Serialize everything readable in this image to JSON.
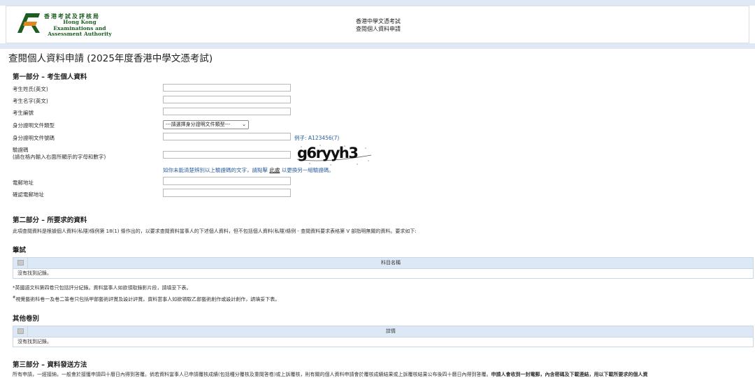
{
  "header": {
    "logo_cn": "香港考試及評核局",
    "logo_en_1": "Hong Kong",
    "logo_en_2": "Examinations and",
    "logo_en_3": "Assessment Authority",
    "title_1": "香港中學文憑考試",
    "title_2": "查閱個人資料申請"
  },
  "page_title": "查閱個人資料申請 (2025年度香港中學文憑考試)",
  "part1": {
    "heading": "第一部分 – 考生個人資料",
    "surname_label": "考生姓氏(英文)",
    "given_name_label": "考生名字(英文)",
    "candidate_no_label": "考生編號",
    "id_type_label": "身分證明文件類型",
    "id_type_selected": "---請選擇身分證明文件類型---",
    "id_no_label": "身分證明文件號碼",
    "id_no_example": "例子: A123456(7)",
    "captcha_label_1": "驗證碼",
    "captcha_label_2": "(請在格內輸入右面所顯示的字母和數字)",
    "captcha_text": "g6ryyh3",
    "captcha_hint_pre": "如你未能清楚辨別以上驗證碼的文字，請點擊",
    "captcha_hint_link": "此處",
    "captcha_hint_post": "以更換另一組驗證碼。",
    "email_label": "電郵地址",
    "confirm_email_label": "確認電郵地址"
  },
  "part2": {
    "heading": "第二部分 – 所要求的資料",
    "desc": "此項查閱資料是根據個人資料(私隱)條例第 18(1) 條作出的，以要求查閱資料當事人的下述個人資料，但不包括個人資料(私隱)條例 - 查閱資料要求表格第 V 部指明無關的資料。要求如下:",
    "written_heading": "筆試",
    "written_col": "科目名稱",
    "written_empty": "沒有找到記錄。",
    "note_1": "*英國語文科第四卷只包括評分紀錄。資料當事人如欲領取錄影片段，請填妥下表。",
    "note_2_mark": "#",
    "note_2": "視覺藝術科卷一及卷二答卷只包括甲部藝術評賞及設計評賞。資料當事人如欲領取乙部藝術創作或設計創作，請填妥下表。",
    "other_heading": "其他卷別",
    "other_col": "詳情",
    "other_empty": "沒有找到記錄。"
  },
  "part3": {
    "heading": "第三部分 – 資料發送方法",
    "desc": "所有申請，一經接納，一般會於接獲申請四十曆日內得到答覆。倘若資料當事人已申請覆核成績(包括種分覆核及重閱答卷)或上訴覆核，則有關的個人資料申請會於覆核成績結果或上訴覆核結果公布後四十曆日內得到答覆。",
    "desc_bold": "申請人會收到一封電郵，內含密碼及下載連結，用以下載所要求的個人資"
  },
  "colors": {
    "band": "#dfe9f4",
    "table_header": "#dce8f5",
    "link": "#2a5d9f",
    "logo_green": "#1b5e20"
  }
}
